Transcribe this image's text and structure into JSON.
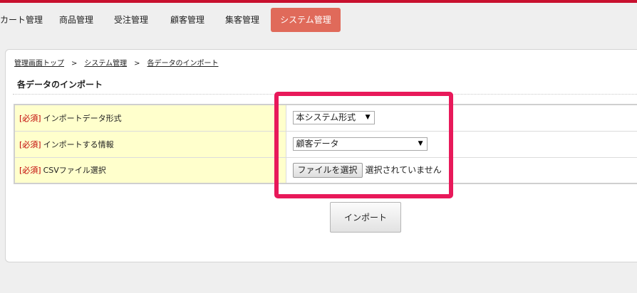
{
  "nav": {
    "items": [
      {
        "label": "カート管理"
      },
      {
        "label": "商品管理"
      },
      {
        "label": "受注管理"
      },
      {
        "label": "顧客管理"
      },
      {
        "label": "集客管理"
      },
      {
        "label": "システム管理"
      }
    ],
    "active": "システム管理"
  },
  "breadcrumb": {
    "items": [
      "管理画面トップ",
      "システム管理",
      "各データのインポート"
    ],
    "separator": ">"
  },
  "section": {
    "title": "各データのインポート"
  },
  "form": {
    "required_tag": "[必須]",
    "rows": [
      {
        "label": "インポートデータ形式",
        "control": "select",
        "value": "本システム形式"
      },
      {
        "label": "インポートする情報",
        "control": "select",
        "value": "顧客データ"
      },
      {
        "label": "CSVファイル選択",
        "control": "file",
        "button_label": "ファイルを選択",
        "status": "選択されていません"
      }
    ]
  },
  "import_button": {
    "label": "インポート"
  },
  "colors": {
    "brand_bar": "#c8102e",
    "active_tab": "#e06a5a",
    "label_bg": "#ffffcc",
    "required_text": "#c00000",
    "annotation": "#e8195a"
  },
  "icons": {
    "select_arrow": "triangle-down-icon"
  }
}
